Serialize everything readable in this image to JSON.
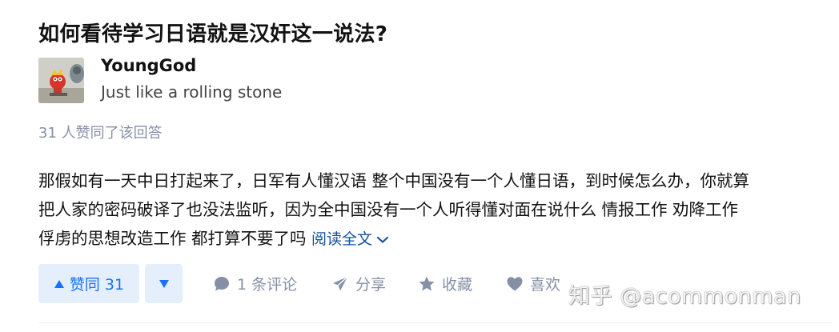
{
  "question": {
    "title": "如何看待学习日语就是汉奸这一说法?"
  },
  "author": {
    "name": "YoungGod",
    "bio": "Just like a rolling stone",
    "avatar_icon": "avatar-image"
  },
  "voters_text": "31 人赞同了该回答",
  "content": {
    "lines": [
      "那假如有一天中日打起来了，日军有人懂汉语 整个中国没有一个人懂日语，到时候怎么办，你就算",
      "把人家的密码破译了也没法监听，因为全中国没有一个人听得懂对面在说什么 情报工作 劝降工作",
      "俘虏的思想改造工作 都打算不要了吗"
    ],
    "read_more": "阅读全文"
  },
  "actions": {
    "upvote_label": "赞同 31",
    "comment_label": "1 条评论",
    "share_label": "分享",
    "favorite_label": "收藏",
    "like_label": "喜欢"
  },
  "watermark": "知乎 @acommonman",
  "colors": {
    "accent": "#1772f6",
    "vote_bg": "#e5effc",
    "muted": "#8590a6",
    "link": "#175199"
  }
}
